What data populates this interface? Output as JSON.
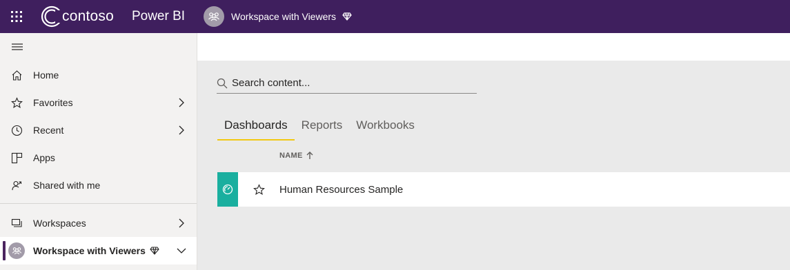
{
  "topbar": {
    "logo_text": "contoso",
    "product_name": "Power BI",
    "workspace_name": "Workspace with Viewers",
    "icons": {
      "app_launcher": "waffle-icon",
      "workspace": "people-icon",
      "premium": "diamond-icon"
    }
  },
  "sidebar": {
    "items": [
      {
        "label": "Home",
        "icon": "home-icon"
      },
      {
        "label": "Favorites",
        "icon": "star-icon"
      },
      {
        "label": "Recent",
        "icon": "clock-icon"
      },
      {
        "label": "Apps",
        "icon": "apps-icon"
      },
      {
        "label": "Shared with me",
        "icon": "shared-icon"
      },
      {
        "label": "Workspaces",
        "icon": "workspaces-icon"
      }
    ],
    "active_workspace": {
      "label": "Workspace with Viewers"
    }
  },
  "main": {
    "search": {
      "placeholder": "Search content..."
    },
    "tabs": [
      {
        "label": "Dashboards",
        "active": true
      },
      {
        "label": "Reports",
        "active": false
      },
      {
        "label": "Workbooks",
        "active": false
      }
    ],
    "table": {
      "column_name": "NAME",
      "rows": [
        {
          "name": "Human Resources Sample",
          "type": "dashboard"
        }
      ]
    }
  },
  "colors": {
    "topbar_bg": "#3f1f5e",
    "active_tab_underline": "#f2c811",
    "dashboard_icon_bg": "#1aaf9f"
  }
}
